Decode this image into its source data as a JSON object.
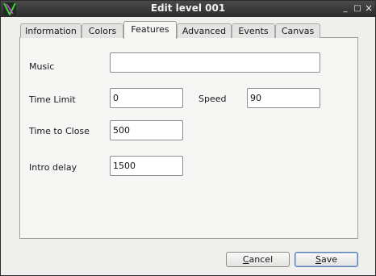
{
  "window": {
    "title": "Edit level 001",
    "controls": {
      "minimize": "_",
      "maximize": "□",
      "close": "×"
    }
  },
  "tabs": [
    {
      "label": "Information"
    },
    {
      "label": "Colors"
    },
    {
      "label": "Features",
      "active": true
    },
    {
      "label": "Advanced"
    },
    {
      "label": "Events"
    },
    {
      "label": "Canvas"
    }
  ],
  "features": {
    "music": {
      "label": "Music",
      "value": ""
    },
    "time_limit": {
      "label": "Time Limit",
      "value": "0"
    },
    "speed": {
      "label": "Speed",
      "value": "90"
    },
    "time_to_close": {
      "label": "Time to Close",
      "value": "500"
    },
    "intro_delay": {
      "label": "Intro delay",
      "value": "1500"
    }
  },
  "buttons": {
    "cancel": {
      "mnemonic": "C",
      "rest": "ancel"
    },
    "save": {
      "mnemonic": "S",
      "rest": "ave"
    }
  },
  "colors": {
    "titlebar": "#2c2c2c",
    "window_bg": "#efefed",
    "panel_bg": "#f6f6f4",
    "default_button_border": "#5a7fb0"
  }
}
